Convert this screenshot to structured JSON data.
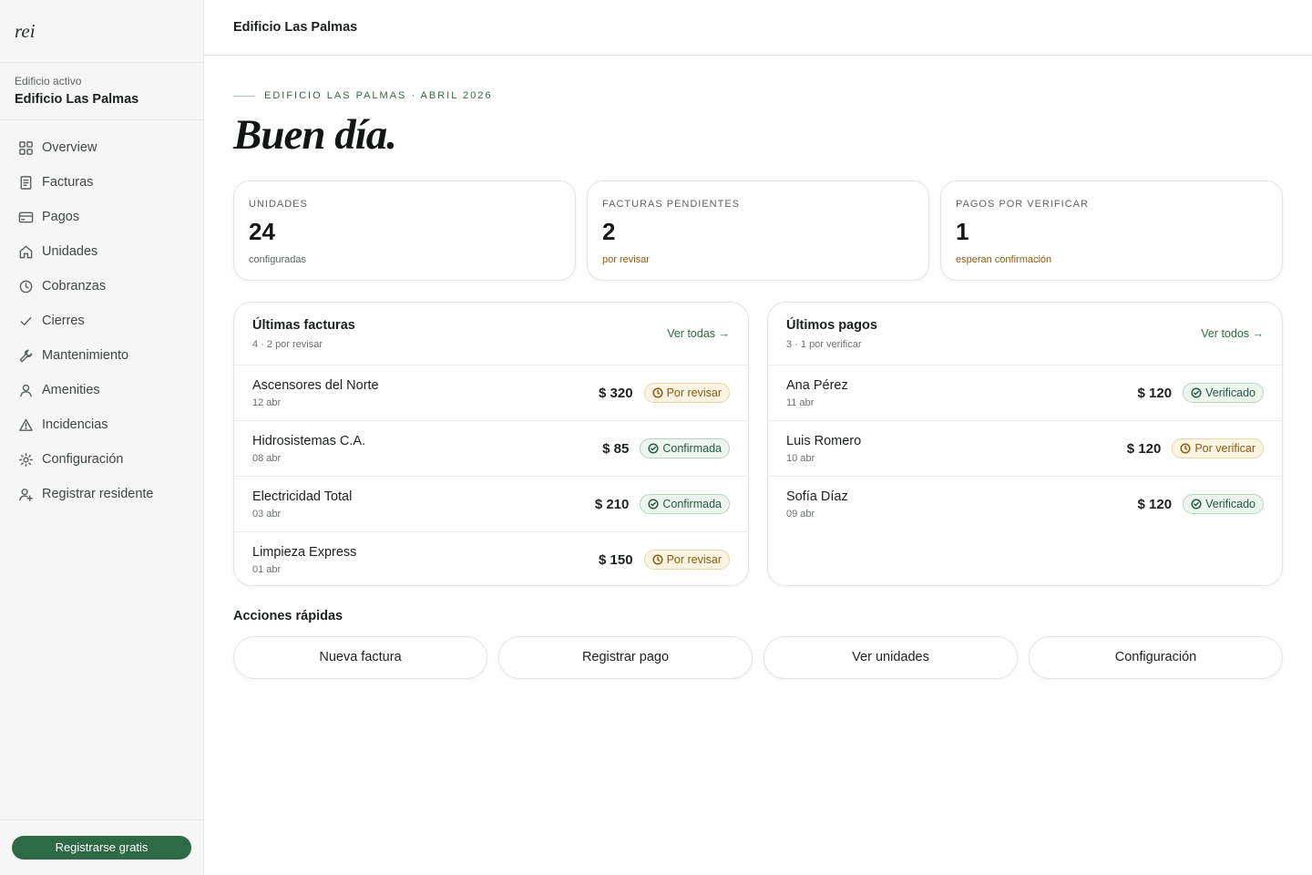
{
  "app": {
    "logo": "rei"
  },
  "sidebar": {
    "building_label": "Edificio activo",
    "building_name": "Edificio Las Palmas",
    "items": [
      {
        "label": "Overview",
        "icon": "grid-icon"
      },
      {
        "label": "Facturas",
        "icon": "document-icon"
      },
      {
        "label": "Pagos",
        "icon": "credit-card-icon"
      },
      {
        "label": "Unidades",
        "icon": "home-icon"
      },
      {
        "label": "Cobranzas",
        "icon": "clock-icon"
      },
      {
        "label": "Cierres",
        "icon": "check-icon"
      },
      {
        "label": "Mantenimiento",
        "icon": "wrench-icon"
      },
      {
        "label": "Amenities",
        "icon": "user-icon"
      },
      {
        "label": "Incidencias",
        "icon": "warning-icon"
      },
      {
        "label": "Configuración",
        "icon": "gear-icon"
      },
      {
        "label": "Registrar residente",
        "icon": "user-plus-icon"
      }
    ],
    "signup_label": "Registrarse gratis"
  },
  "header": {
    "title": "Edificio Las Palmas"
  },
  "hero": {
    "eyebrow": "EDIFICIO LAS PALMAS · ABRIL 2026",
    "greeting": "Buen día."
  },
  "stats": [
    {
      "label": "UNIDADES",
      "value": "24",
      "sub": "configuradas"
    },
    {
      "label": "FACTURAS PENDIENTES",
      "value": "2",
      "sub": "por revisar"
    },
    {
      "label": "PAGOS POR VERIFICAR",
      "value": "1",
      "sub": "esperan confirmación"
    }
  ],
  "invoices": {
    "title": "Últimas facturas",
    "subtitle": "4 · 2 por revisar",
    "link": "Ver todas →",
    "rows": [
      {
        "name": "Ascensores del Norte",
        "date": "12 abr",
        "amount": "$ 320",
        "status": "Por revisar"
      },
      {
        "name": "Hidrosistemas C.A.",
        "date": "08 abr",
        "amount": "$ 85",
        "status": "Confirmada"
      },
      {
        "name": "Electricidad Total",
        "date": "03 abr",
        "amount": "$ 210",
        "status": "Confirmada"
      },
      {
        "name": "Limpieza Express",
        "date": "01 abr",
        "amount": "$ 150",
        "status": "Por revisar"
      }
    ]
  },
  "payments": {
    "title": "Últimos pagos",
    "subtitle": "3 · 1 por verificar",
    "link": "Ver todos →",
    "rows": [
      {
        "name": "Ana Pérez",
        "date": "11 abr",
        "amount": "$ 120",
        "status": "Verificado"
      },
      {
        "name": "Luis Romero",
        "date": "10 abr",
        "amount": "$ 120",
        "status": "Por verificar"
      },
      {
        "name": "Sofía Díaz",
        "date": "09 abr",
        "amount": "$ 120",
        "status": "Verificado"
      }
    ]
  },
  "quick_actions": {
    "title": "Acciones rápidas",
    "buttons": [
      "Nueva factura",
      "Registrar pago",
      "Ver unidades",
      "Configuración"
    ]
  },
  "colors": {
    "accent": "#2f6a47",
    "warn": "#8a5d10",
    "warn_bg": "#fbf4e3",
    "ok_bg": "#edf5ef"
  }
}
